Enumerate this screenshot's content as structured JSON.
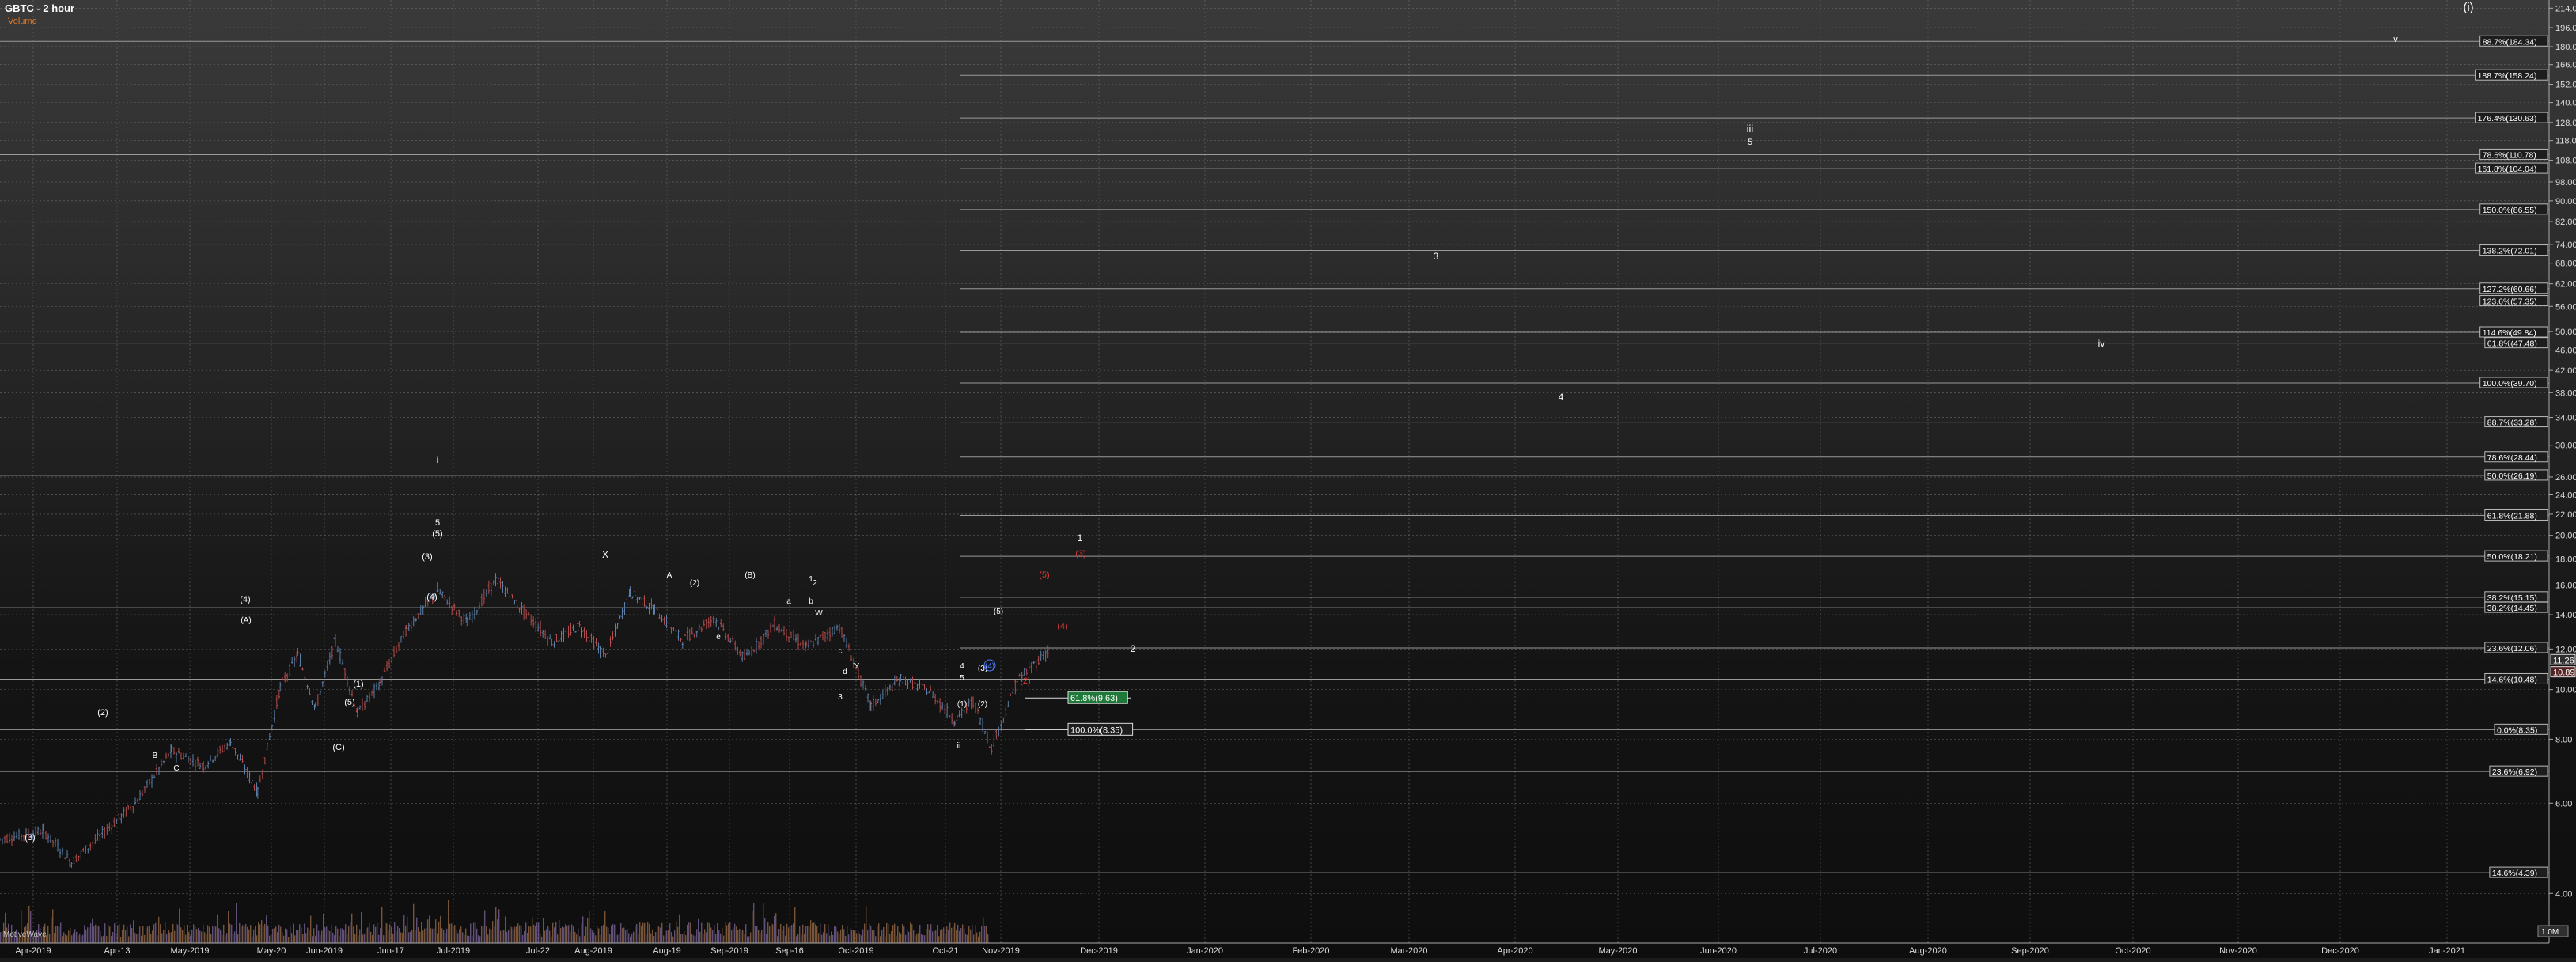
{
  "header": {
    "title": "GBTC - 2 hour",
    "subtitle": "Volume"
  },
  "footer": {
    "wave_label": "MotiveWave",
    "volume_readout": "1.0M"
  },
  "colors": {
    "background_top": "#3a3a3a",
    "background_bottom": "#0e0e0e",
    "grid": "#6a6a6a",
    "fib_line": "#9a9a9a",
    "up_bar": "#5b7fa8",
    "down_bar": "#b24b4b",
    "label_white": "#ffffff",
    "label_red": "#d23a3a",
    "label_blue": "#4a7cff",
    "volume": "#8a6040",
    "title_color": "#ffffff",
    "subtitle_color": "#e07b2a",
    "box_green": "#1f7a3a",
    "price_box": "#2f2f2f"
  },
  "chart_data": {
    "type": "candlestick",
    "title": "GBTC - 2 hour",
    "y_scale": "log",
    "ylim": [
      3.2,
      222
    ],
    "y_ticks": [
      "214.00",
      "196.00",
      "180.00",
      "166.00",
      "152.00",
      "140.00",
      "128.00",
      "118.00",
      "108.00",
      "98.00",
      "90.00",
      "82.00",
      "74.00",
      "68.00",
      "62.00",
      "56.00",
      "50.00",
      "46.00",
      "42.00",
      "38.00",
      "34.00",
      "30.00",
      "26.00",
      "24.00",
      "22.00",
      "20.00",
      "18.00",
      "16.00",
      "14.00",
      "12.00",
      "10.00",
      "8.00",
      "6.00",
      "4.00"
    ],
    "x_ticks": [
      "Apr-2019",
      "Apr-13",
      "May-2019",
      "May-20",
      "Jun-2019",
      "Jun-17",
      "Jul-2019",
      "Jul-22",
      "Aug-2019",
      "Aug-19",
      "Sep-2019",
      "Sep-16",
      "Oct-2019",
      "Oct-21",
      "Nov-2019",
      "Dec-2019",
      "Jan-2020",
      "Feb-2020",
      "Mar-2020",
      "Apr-2020",
      "May-2020",
      "Jun-2020",
      "Jul-2020",
      "Aug-2020",
      "Sep-2020",
      "Oct-2020",
      "Nov-2020",
      "Dec-2020",
      "Jan-2021"
    ],
    "price_path": [
      [
        "Apr-2019",
        5.1
      ],
      [
        "Apr-2019",
        5.3
      ],
      [
        "Apr-2019",
        4.6
      ],
      [
        "Apr-13",
        6.0
      ],
      [
        "Apr-13",
        7.6
      ],
      [
        "May-2019",
        7.1
      ],
      [
        "May-2019",
        7.9
      ],
      [
        "May-2019",
        6.3
      ],
      [
        "May-20",
        10.1
      ],
      [
        "May-20",
        11.7
      ],
      [
        "May-20",
        9.2
      ],
      [
        "Jun-2019",
        12.5
      ],
      [
        "Jun-2019",
        9.0
      ],
      [
        "Jun-2019",
        10.3
      ],
      [
        "Jun-17",
        13.1
      ],
      [
        "Jun-17",
        15.6
      ],
      [
        "Jul-2019",
        13.5
      ],
      [
        "Jul-2019",
        16.4
      ],
      [
        "Jul-2019",
        14.2
      ],
      [
        "Jul-22",
        12.4
      ],
      [
        "Jul-22",
        13.3
      ],
      [
        "Aug-2019",
        11.6
      ],
      [
        "Aug-2019",
        15.5
      ],
      [
        "Aug-2019",
        14.3
      ],
      [
        "Aug-19",
        12.5
      ],
      [
        "Aug-19",
        13.8
      ],
      [
        "Sep-2019",
        11.5
      ],
      [
        "Sep-2019",
        13.4
      ],
      [
        "Sep-16",
        12.1
      ],
      [
        "Sep-16",
        13.3
      ],
      [
        "Oct-2019",
        9.3
      ],
      [
        "Oct-2019",
        10.5
      ],
      [
        "Oct-2019",
        9.9
      ],
      [
        "Oct-21",
        8.7
      ],
      [
        "Oct-21",
        9.5
      ],
      [
        "Oct-21",
        7.7
      ],
      [
        "Nov-2019",
        10.4
      ],
      [
        "Nov-2019",
        12.0
      ],
      [
        "Nov-2019",
        11.26
      ]
    ],
    "last_price": "11.26",
    "last_price_low": "10.89",
    "fib_levels_right": [
      "88.7%(184.34)",
      "188.7%(158.24)",
      "176.4%(130.63)",
      "78.6%(110.78)",
      "161.8%(104.04)",
      "150.0%(86.55)",
      "138.2%(72.01)",
      "127.2%(60.66)",
      "123.6%(57.35)",
      "114.6%(49.84)",
      "61.8%(47.48)",
      "100.0%(39.70)",
      "88.7%(33.28)",
      "78.6%(28.44)",
      "50.0%(26.19)",
      "61.8%(21.88)",
      "50.0%(18.21)",
      "38.2%(15.15)",
      "38.2%(14.45)",
      "23.6%(12.06)",
      "14.6%(10.48)",
      "0.0%(8.35)",
      "23.6%(6.92)",
      "14.6%(4.39)"
    ],
    "fib_boxes_inline": [
      "61.8%(9.63)",
      "100.0%(8.35)"
    ],
    "wave_labels_white": [
      "(i)",
      "v",
      "iii",
      "5",
      "3",
      "4",
      "iv",
      "1",
      "2",
      "ii",
      "i",
      "5",
      "(5)",
      "(3)",
      "(4)",
      "X",
      "A",
      "B",
      "C",
      "(B)",
      "(A)",
      "(C)",
      "(1)",
      "(2)",
      "(3)",
      "(4)",
      "(5)",
      "(2)",
      "a",
      "b",
      "c",
      "d",
      "e",
      "W",
      "Y",
      "1",
      "2",
      "3",
      "4",
      "5",
      "(1)",
      "(2)",
      "(3)",
      "(5)"
    ],
    "wave_labels_red": [
      "(3)",
      "(5)",
      "(4)",
      "(2)"
    ],
    "wave_labels_blue": [
      "(4)"
    ],
    "volume": "histogram"
  }
}
